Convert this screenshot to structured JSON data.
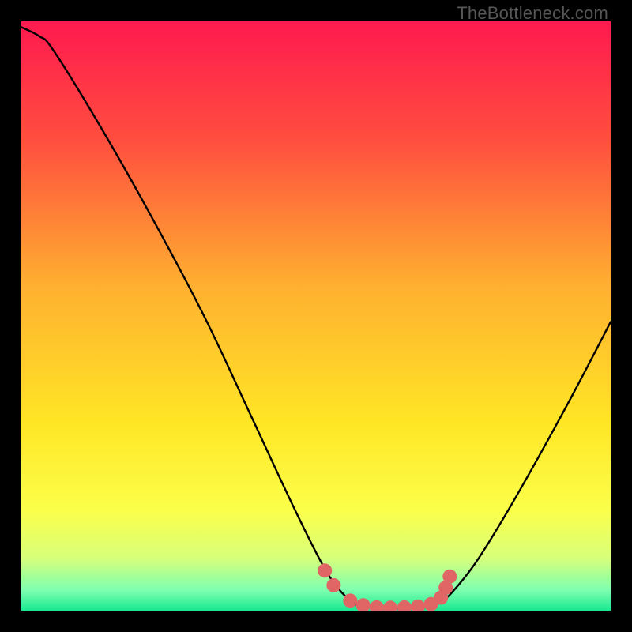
{
  "attribution": "TheBottleneck.com",
  "chart_data": {
    "type": "line",
    "title": "",
    "xlabel": "",
    "ylabel": "",
    "xlim": [
      0,
      100
    ],
    "ylim": [
      0,
      100
    ],
    "gradient_stops": [
      {
        "offset": 0.0,
        "color": "#ff1a4f"
      },
      {
        "offset": 0.2,
        "color": "#ff4d3f"
      },
      {
        "offset": 0.45,
        "color": "#ffb030"
      },
      {
        "offset": 0.68,
        "color": "#ffe625"
      },
      {
        "offset": 0.83,
        "color": "#fbff4a"
      },
      {
        "offset": 0.91,
        "color": "#d8ff7a"
      },
      {
        "offset": 0.965,
        "color": "#7fffb0"
      },
      {
        "offset": 1.0,
        "color": "#17e890"
      }
    ],
    "series": [
      {
        "name": "curve-left",
        "type": "path",
        "stroke": "#000000",
        "values": [
          {
            "x": 0.0,
            "y": 99.0
          },
          {
            "x": 3.0,
            "y": 97.5
          },
          {
            "x": 5.5,
            "y": 95.0
          },
          {
            "x": 13.5,
            "y": 82.0
          },
          {
            "x": 22.0,
            "y": 67.0
          },
          {
            "x": 31.0,
            "y": 50.0
          },
          {
            "x": 39.0,
            "y": 33.0
          },
          {
            "x": 46.0,
            "y": 18.0
          },
          {
            "x": 51.0,
            "y": 8.0
          },
          {
            "x": 54.0,
            "y": 3.5
          },
          {
            "x": 56.5,
            "y": 1.2
          }
        ]
      },
      {
        "name": "curve-flat",
        "type": "path",
        "stroke": "#000000",
        "values": [
          {
            "x": 56.5,
            "y": 1.2
          },
          {
            "x": 58.0,
            "y": 0.7
          },
          {
            "x": 63.0,
            "y": 0.4
          },
          {
            "x": 68.0,
            "y": 0.6
          },
          {
            "x": 71.0,
            "y": 1.3
          }
        ]
      },
      {
        "name": "curve-right",
        "type": "path",
        "stroke": "#000000",
        "values": [
          {
            "x": 71.0,
            "y": 1.3
          },
          {
            "x": 73.0,
            "y": 3.0
          },
          {
            "x": 77.0,
            "y": 8.0
          },
          {
            "x": 82.0,
            "y": 16.0
          },
          {
            "x": 88.0,
            "y": 26.5
          },
          {
            "x": 94.0,
            "y": 37.5
          },
          {
            "x": 100.0,
            "y": 49.0
          }
        ]
      },
      {
        "name": "dotted-highlight",
        "type": "points",
        "color": "#e06666",
        "radius_px": 9,
        "values": [
          {
            "x": 51.5,
            "y": 6.8
          },
          {
            "x": 53.0,
            "y": 4.3
          },
          {
            "x": 55.8,
            "y": 1.7
          },
          {
            "x": 58.0,
            "y": 0.9
          },
          {
            "x": 60.3,
            "y": 0.55
          },
          {
            "x": 62.6,
            "y": 0.5
          },
          {
            "x": 65.0,
            "y": 0.55
          },
          {
            "x": 67.3,
            "y": 0.7
          },
          {
            "x": 69.5,
            "y": 1.1
          },
          {
            "x": 71.2,
            "y": 2.2
          },
          {
            "x": 72.0,
            "y": 3.9
          },
          {
            "x": 72.7,
            "y": 5.8
          }
        ]
      }
    ]
  }
}
